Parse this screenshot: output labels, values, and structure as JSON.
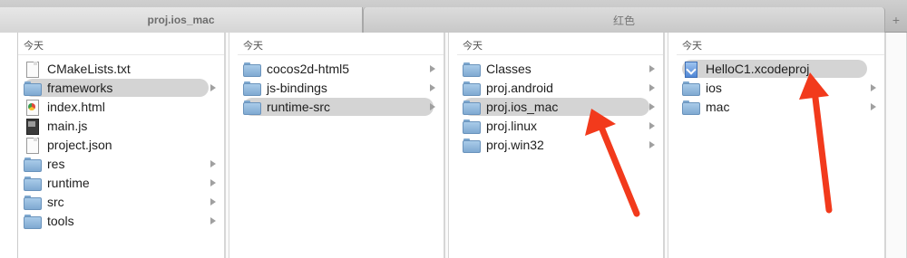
{
  "tabs": [
    {
      "label": "proj.ios_mac",
      "active": true
    },
    {
      "label": "红色",
      "active": false
    }
  ],
  "add_tab_symbol": "+",
  "columns": [
    {
      "header": "今天",
      "items": [
        {
          "name": "CMakeLists.txt",
          "icon": "document-icon",
          "folder": false,
          "selected": false
        },
        {
          "name": "frameworks",
          "icon": "folder-icon",
          "folder": true,
          "selected": true
        },
        {
          "name": "index.html",
          "icon": "html-file-icon",
          "folder": false,
          "selected": false
        },
        {
          "name": "main.js",
          "icon": "js-file-icon",
          "folder": false,
          "selected": false
        },
        {
          "name": "project.json",
          "icon": "document-icon",
          "folder": false,
          "selected": false
        },
        {
          "name": "res",
          "icon": "folder-icon",
          "folder": true,
          "selected": false
        },
        {
          "name": "runtime",
          "icon": "folder-icon",
          "folder": true,
          "selected": false
        },
        {
          "name": "src",
          "icon": "folder-icon",
          "folder": true,
          "selected": false
        },
        {
          "name": "tools",
          "icon": "folder-icon",
          "folder": true,
          "selected": false
        }
      ]
    },
    {
      "header": "今天",
      "items": [
        {
          "name": "cocos2d-html5",
          "icon": "folder-icon",
          "folder": true,
          "selected": false
        },
        {
          "name": "js-bindings",
          "icon": "folder-icon",
          "folder": true,
          "selected": false
        },
        {
          "name": "runtime-src",
          "icon": "folder-icon",
          "folder": true,
          "selected": true
        }
      ]
    },
    {
      "header": "今天",
      "items": [
        {
          "name": "Classes",
          "icon": "folder-icon",
          "folder": true,
          "selected": false
        },
        {
          "name": "proj.android",
          "icon": "folder-icon",
          "folder": true,
          "selected": false
        },
        {
          "name": "proj.ios_mac",
          "icon": "folder-icon",
          "folder": true,
          "selected": true
        },
        {
          "name": "proj.linux",
          "icon": "folder-icon",
          "folder": true,
          "selected": false
        },
        {
          "name": "proj.win32",
          "icon": "folder-icon",
          "folder": true,
          "selected": false
        }
      ]
    },
    {
      "header": "今天",
      "items": [
        {
          "name": "HelloC1.xcodeproj",
          "icon": "xcodeproj-icon",
          "folder": false,
          "selected": true
        },
        {
          "name": "ios",
          "icon": "folder-icon",
          "folder": true,
          "selected": false
        },
        {
          "name": "mac",
          "icon": "folder-icon",
          "folder": true,
          "selected": false
        }
      ]
    }
  ],
  "colors": {
    "selection": "#d4d4d4",
    "folder": "#8fb6de",
    "arrow": "#f23a1c"
  }
}
